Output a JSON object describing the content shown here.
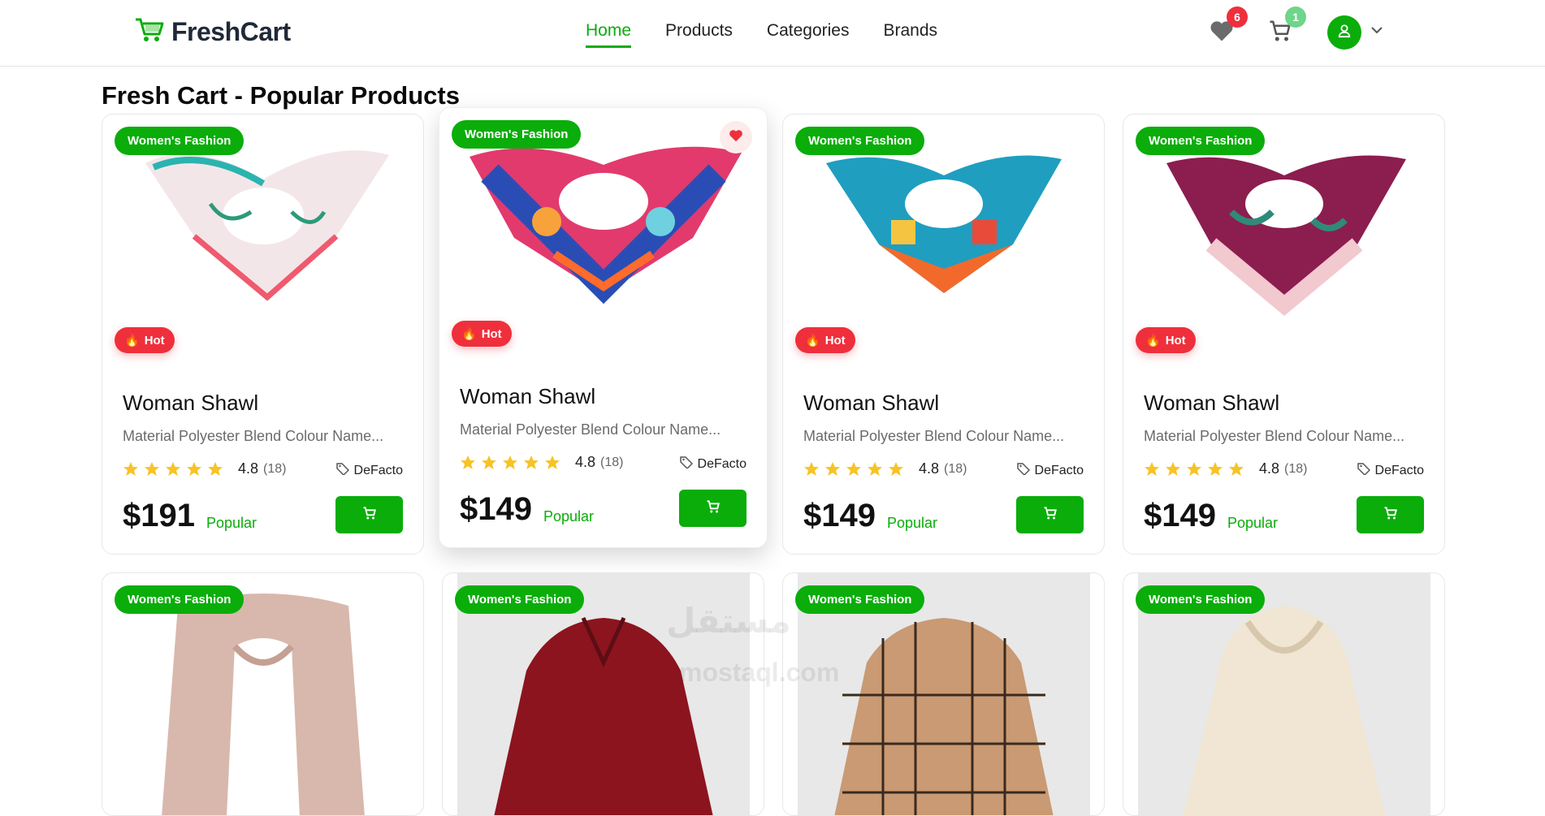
{
  "navbar": {
    "brand": "FreshCart",
    "links": [
      "Home",
      "Products",
      "Categories",
      "Brands"
    ],
    "wishlist_count": "6",
    "cart_count": "1",
    "colors": {
      "brand_green": "#0aad0a",
      "wishlist_badge": "#ef2f3c",
      "cart_badge": "#5fd37a"
    }
  },
  "page": {
    "title": "Fresh Cart - Popular Products"
  },
  "products": [
    {
      "category": "Women's Fashion",
      "badge": "Hot",
      "title": "Woman Shawl",
      "description": "Material Polyester Blend Colour Name...",
      "rating": "4.8",
      "rating_count": "(18)",
      "brand": "DeFacto",
      "price": "$191",
      "label": "Popular",
      "favorited": false
    },
    {
      "category": "Women's Fashion",
      "badge": "Hot",
      "title": "Woman Shawl",
      "description": "Material Polyester Blend Colour Name...",
      "rating": "4.8",
      "rating_count": "(18)",
      "brand": "DeFacto",
      "price": "$149",
      "label": "Popular",
      "favorited": true
    },
    {
      "category": "Women's Fashion",
      "badge": "Hot",
      "title": "Woman Shawl",
      "description": "Material Polyester Blend Colour Name...",
      "rating": "4.8",
      "rating_count": "(18)",
      "brand": "DeFacto",
      "price": "$149",
      "label": "Popular",
      "favorited": false
    },
    {
      "category": "Women's Fashion",
      "badge": "Hot",
      "title": "Woman Shawl",
      "description": "Material Polyester Blend Colour Name...",
      "rating": "4.8",
      "rating_count": "(18)",
      "brand": "DeFacto",
      "price": "$149",
      "label": "Popular",
      "favorited": false
    }
  ],
  "products_row2": [
    {
      "category": "Women's Fashion"
    },
    {
      "category": "Women's Fashion"
    },
    {
      "category": "Women's Fashion"
    },
    {
      "category": "Women's Fashion"
    }
  ],
  "watermark": {
    "arabic": "مستقل",
    "latin": "mostaql.com"
  }
}
